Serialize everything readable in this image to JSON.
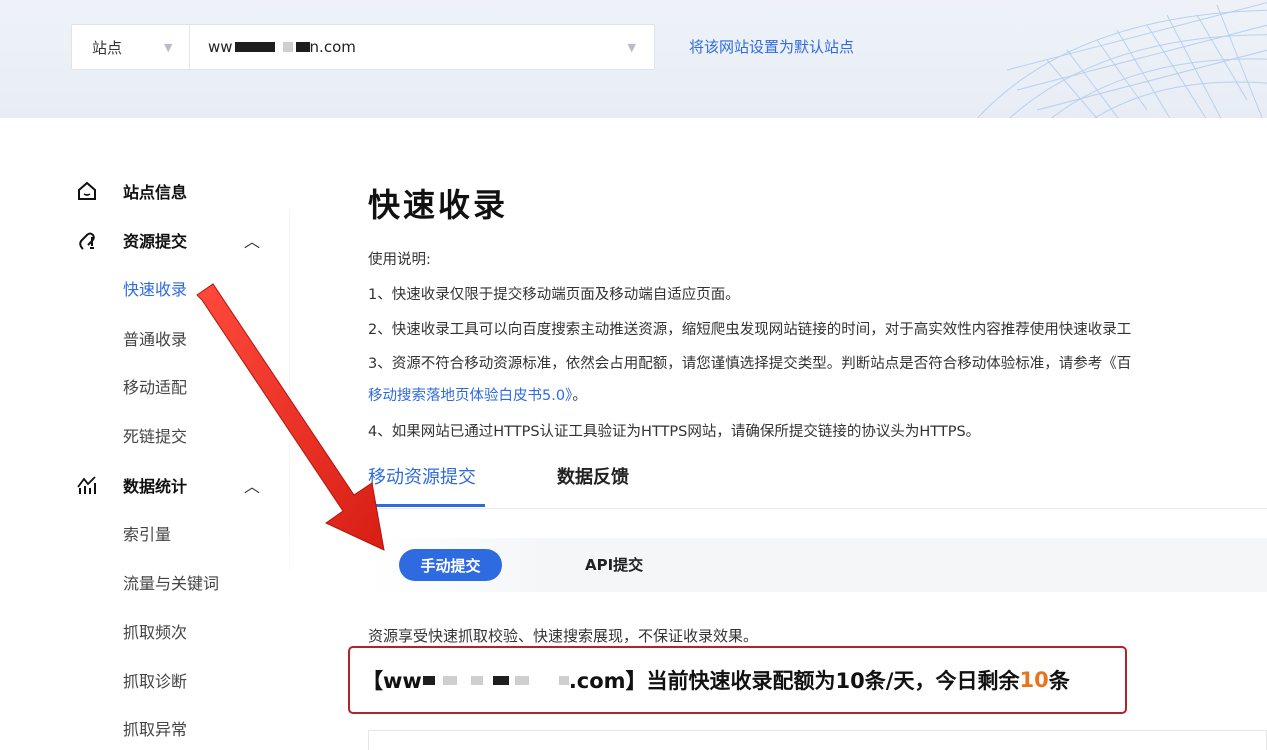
{
  "header": {
    "site_label": "站点",
    "domain_prefix": "ww",
    "domain_suffix": "n.com",
    "set_default_link": "将该网站设置为默认站点"
  },
  "sidebar": {
    "groups": [
      {
        "title": "站点信息",
        "icon": "home-icon"
      },
      {
        "title": "资源提交",
        "icon": "submit-icon",
        "expanded": true,
        "items": [
          "快速收录",
          "普通收录",
          "移动适配",
          "死链提交"
        ]
      },
      {
        "title": "数据统计",
        "icon": "stats-icon",
        "expanded": true,
        "items": [
          "索引量",
          "流量与关键词",
          "抓取频次",
          "抓取诊断",
          "抓取异常"
        ]
      }
    ],
    "active_item": "快速收录"
  },
  "main": {
    "title": "快速收录",
    "usage_heading": "使用说明:",
    "instructions": [
      "1、快速收录仅限于提交移动端页面及移动端自适应页面。",
      "2、快速收录工具可以向百度搜索主动推送资源，缩短爬虫发现网站链接的时间，对于高实效性内容推荐使用快速收录工",
      "3、资源不符合移动资源标准，依然会占用配额，请您谨慎选择提交类型。判断站点是否符合移动体验标准，请参考《百",
      "4、如果网站已通过HTTPS认证工具验证为HTTPS网站，请确保所提交链接的协议头为HTTPS。"
    ],
    "instruction_link": "移动搜索落地页体验白皮书5.0》",
    "instruction_link_tail": "。",
    "tabs": [
      "移动资源提交",
      "数据反馈"
    ],
    "subtabs": [
      "手动提交",
      "API提交"
    ],
    "note": "资源享受快速抓取校验、快速搜索展现，不保证收录效果。",
    "quota": {
      "open": "【ww",
      "domain_tail": ".com】当前快速收录配额为10条/天，今日剩余",
      "remaining": "10",
      "unit": "条"
    }
  },
  "colors": {
    "accent": "#2f6be0",
    "highlight": "#e8741e",
    "box_border": "#b0242a",
    "arrow": "#e0261b"
  }
}
